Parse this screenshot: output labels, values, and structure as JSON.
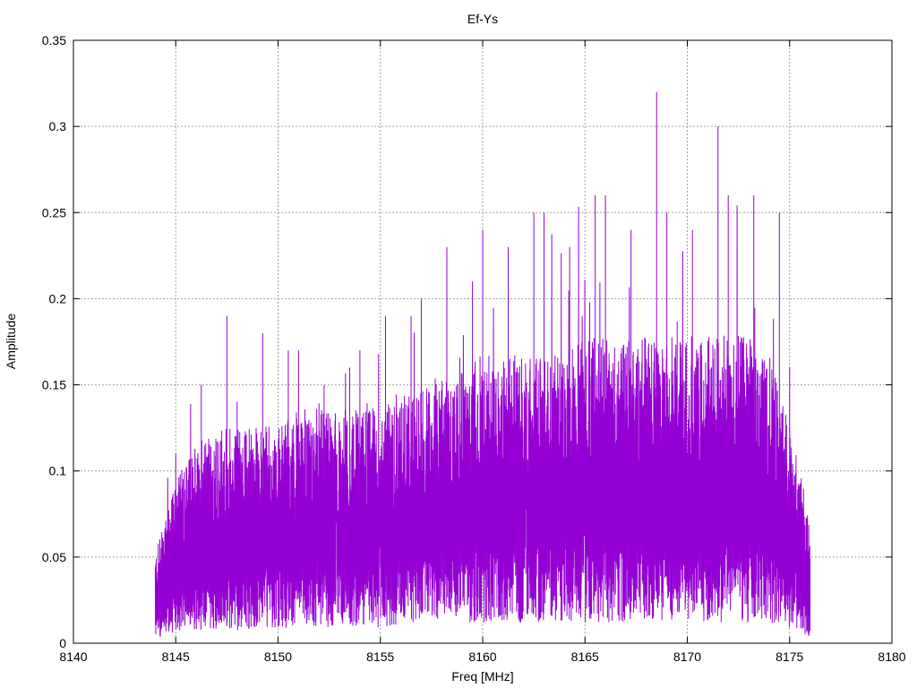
{
  "chart_data": {
    "type": "line",
    "title": "Ef-Ys",
    "xlabel": "Freq [MHz]",
    "ylabel": "Amplitude",
    "xlim": [
      8140,
      8180
    ],
    "ylim": [
      0,
      0.35
    ],
    "xticks": [
      "8140",
      "8145",
      "8150",
      "8155",
      "8160",
      "8165",
      "8170",
      "8175",
      "8180"
    ],
    "yticks": [
      "0",
      "0.05",
      "0.1",
      "0.15",
      "0.2",
      "0.25",
      "0.3",
      "0.35"
    ],
    "grid": true,
    "series": [
      {
        "name": "Ef-Ys",
        "color": "#9400d3",
        "x_range": [
          8144,
          8176
        ],
        "envelope_columns": [
          "freq_mhz",
          "low",
          "typical_high",
          "peak"
        ],
        "envelope": [
          [
            8144,
            0.01,
            0.05,
            0.06
          ],
          [
            8145,
            0.02,
            0.09,
            0.11
          ],
          [
            8146,
            0.025,
            0.11,
            0.15
          ],
          [
            8147,
            0.025,
            0.12,
            0.19
          ],
          [
            8148,
            0.025,
            0.12,
            0.14
          ],
          [
            8149,
            0.03,
            0.12,
            0.18
          ],
          [
            8150,
            0.03,
            0.12,
            0.17
          ],
          [
            8151,
            0.03,
            0.13,
            0.17
          ],
          [
            8152,
            0.03,
            0.13,
            0.15
          ],
          [
            8153,
            0.03,
            0.13,
            0.16
          ],
          [
            8154,
            0.03,
            0.13,
            0.17
          ],
          [
            8155,
            0.03,
            0.13,
            0.19
          ],
          [
            8156,
            0.035,
            0.14,
            0.19
          ],
          [
            8157,
            0.035,
            0.14,
            0.2
          ],
          [
            8158,
            0.04,
            0.15,
            0.23
          ],
          [
            8159,
            0.04,
            0.15,
            0.21
          ],
          [
            8160,
            0.04,
            0.16,
            0.24
          ],
          [
            8161,
            0.04,
            0.16,
            0.23
          ],
          [
            8162,
            0.04,
            0.16,
            0.25
          ],
          [
            8163,
            0.04,
            0.16,
            0.25
          ],
          [
            8164,
            0.04,
            0.16,
            0.23
          ],
          [
            8165,
            0.04,
            0.17,
            0.26
          ],
          [
            8166,
            0.04,
            0.17,
            0.26
          ],
          [
            8167,
            0.04,
            0.17,
            0.24
          ],
          [
            8168,
            0.04,
            0.17,
            0.32
          ],
          [
            8169,
            0.04,
            0.17,
            0.25
          ],
          [
            8170,
            0.04,
            0.17,
            0.24
          ],
          [
            8171,
            0.04,
            0.17,
            0.3
          ],
          [
            8172,
            0.04,
            0.17,
            0.26
          ],
          [
            8173,
            0.04,
            0.17,
            0.26
          ],
          [
            8174,
            0.04,
            0.16,
            0.25
          ],
          [
            8175,
            0.03,
            0.12,
            0.16
          ],
          [
            8176,
            0.01,
            0.07,
            0.1
          ]
        ]
      }
    ]
  }
}
